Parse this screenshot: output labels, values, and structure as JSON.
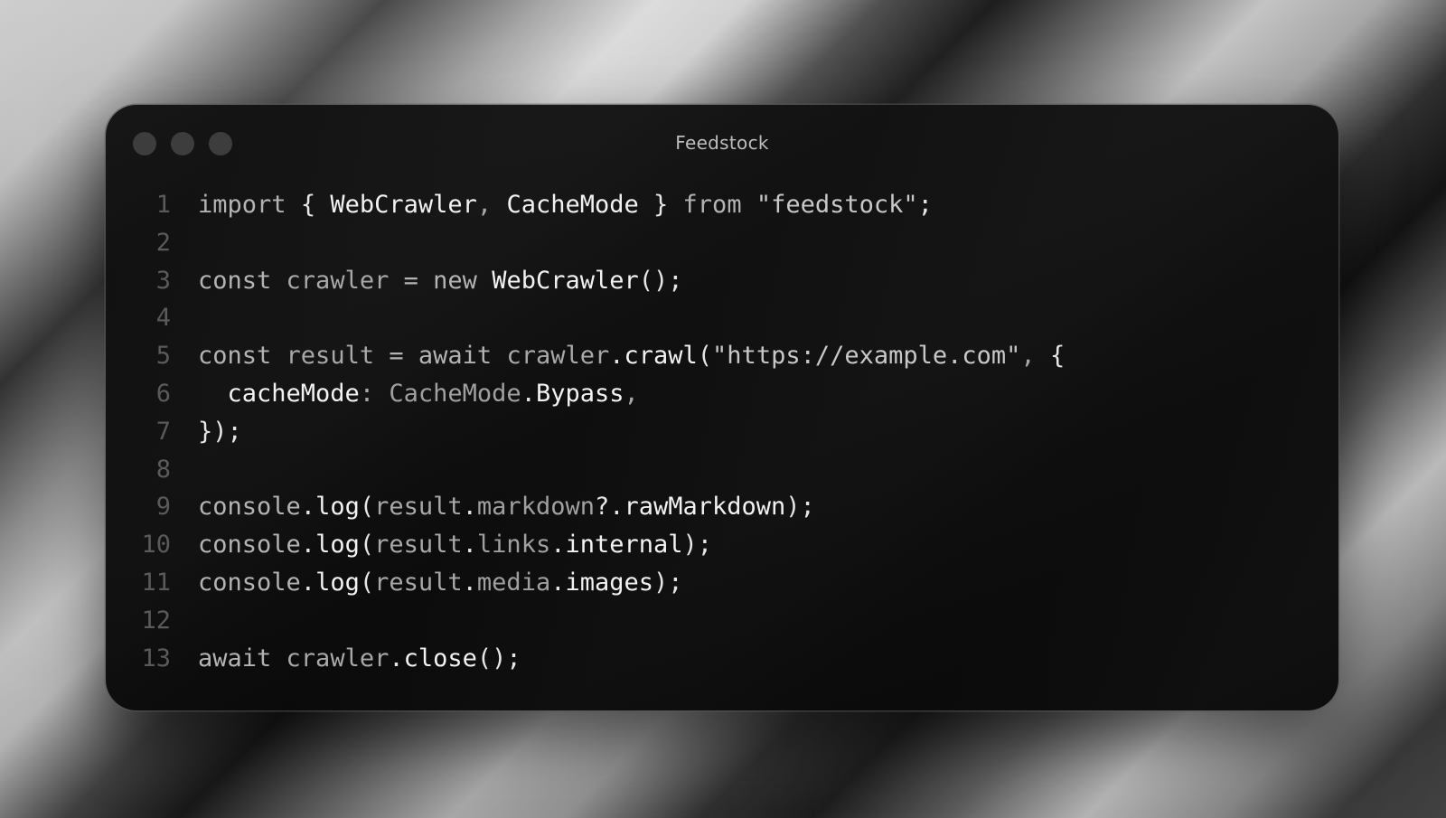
{
  "window": {
    "title": "Feedstock"
  },
  "code": {
    "lines": [
      {
        "number": "1",
        "tokens": [
          {
            "t": "import",
            "k": "kw"
          },
          {
            "t": " ",
            "k": "sp"
          },
          {
            "t": "{",
            "k": "pn"
          },
          {
            "t": " ",
            "k": "sp"
          },
          {
            "t": "WebCrawler",
            "k": "id"
          },
          {
            "t": ",",
            "k": "mut"
          },
          {
            "t": " ",
            "k": "sp"
          },
          {
            "t": "CacheMode",
            "k": "id"
          },
          {
            "t": " ",
            "k": "sp"
          },
          {
            "t": "}",
            "k": "pn"
          },
          {
            "t": " ",
            "k": "sp"
          },
          {
            "t": "from",
            "k": "kw"
          },
          {
            "t": " ",
            "k": "sp"
          },
          {
            "t": "\"feedstock\"",
            "k": "str"
          },
          {
            "t": ";",
            "k": "pn"
          }
        ]
      },
      {
        "number": "2",
        "tokens": []
      },
      {
        "number": "3",
        "tokens": [
          {
            "t": "const",
            "k": "kw"
          },
          {
            "t": " ",
            "k": "sp"
          },
          {
            "t": "crawler",
            "k": "mut"
          },
          {
            "t": " ",
            "k": "sp"
          },
          {
            "t": "=",
            "k": "kw"
          },
          {
            "t": " ",
            "k": "sp"
          },
          {
            "t": "new",
            "k": "kw"
          },
          {
            "t": " ",
            "k": "sp"
          },
          {
            "t": "WebCrawler",
            "k": "id"
          },
          {
            "t": "();",
            "k": "pn"
          }
        ]
      },
      {
        "number": "4",
        "tokens": []
      },
      {
        "number": "5",
        "tokens": [
          {
            "t": "const",
            "k": "kw"
          },
          {
            "t": " ",
            "k": "sp"
          },
          {
            "t": "result",
            "k": "mut"
          },
          {
            "t": " ",
            "k": "sp"
          },
          {
            "t": "=",
            "k": "kw"
          },
          {
            "t": " ",
            "k": "sp"
          },
          {
            "t": "await",
            "k": "kw"
          },
          {
            "t": " ",
            "k": "sp"
          },
          {
            "t": "crawler",
            "k": "mut"
          },
          {
            "t": ".",
            "k": "pn"
          },
          {
            "t": "crawl",
            "k": "id"
          },
          {
            "t": "(",
            "k": "pn"
          },
          {
            "t": "\"https://example.com\"",
            "k": "str"
          },
          {
            "t": ",",
            "k": "mut"
          },
          {
            "t": " ",
            "k": "sp"
          },
          {
            "t": "{",
            "k": "pn"
          }
        ]
      },
      {
        "number": "6",
        "tokens": [
          {
            "t": "  ",
            "k": "sp"
          },
          {
            "t": "cacheMode",
            "k": "id"
          },
          {
            "t": ":",
            "k": "mut"
          },
          {
            "t": " ",
            "k": "sp"
          },
          {
            "t": "CacheMode",
            "k": "pr"
          },
          {
            "t": ".",
            "k": "pn"
          },
          {
            "t": "Bypass",
            "k": "id"
          },
          {
            "t": ",",
            "k": "mut"
          }
        ]
      },
      {
        "number": "7",
        "tokens": [
          {
            "t": "});",
            "k": "pn"
          }
        ]
      },
      {
        "number": "8",
        "tokens": []
      },
      {
        "number": "9",
        "tokens": [
          {
            "t": "console",
            "k": "kw"
          },
          {
            "t": ".",
            "k": "pn"
          },
          {
            "t": "log",
            "k": "id"
          },
          {
            "t": "(",
            "k": "pn"
          },
          {
            "t": "result",
            "k": "mut"
          },
          {
            "t": ".",
            "k": "pn"
          },
          {
            "t": "markdown",
            "k": "pr"
          },
          {
            "t": "?.",
            "k": "pn"
          },
          {
            "t": "rawMarkdown",
            "k": "id"
          },
          {
            "t": ");",
            "k": "pn"
          }
        ]
      },
      {
        "number": "10",
        "tokens": [
          {
            "t": "console",
            "k": "kw"
          },
          {
            "t": ".",
            "k": "pn"
          },
          {
            "t": "log",
            "k": "id"
          },
          {
            "t": "(",
            "k": "pn"
          },
          {
            "t": "result",
            "k": "mut"
          },
          {
            "t": ".",
            "k": "pn"
          },
          {
            "t": "links",
            "k": "pr"
          },
          {
            "t": ".",
            "k": "pn"
          },
          {
            "t": "internal",
            "k": "id"
          },
          {
            "t": ");",
            "k": "pn"
          }
        ]
      },
      {
        "number": "11",
        "tokens": [
          {
            "t": "console",
            "k": "kw"
          },
          {
            "t": ".",
            "k": "pn"
          },
          {
            "t": "log",
            "k": "id"
          },
          {
            "t": "(",
            "k": "pn"
          },
          {
            "t": "result",
            "k": "mut"
          },
          {
            "t": ".",
            "k": "pn"
          },
          {
            "t": "media",
            "k": "pr"
          },
          {
            "t": ".",
            "k": "pn"
          },
          {
            "t": "images",
            "k": "id"
          },
          {
            "t": ");",
            "k": "pn"
          }
        ]
      },
      {
        "number": "12",
        "tokens": []
      },
      {
        "number": "13",
        "tokens": [
          {
            "t": "await",
            "k": "kw"
          },
          {
            "t": " ",
            "k": "sp"
          },
          {
            "t": "crawler",
            "k": "mut"
          },
          {
            "t": ".",
            "k": "pn"
          },
          {
            "t": "close",
            "k": "id"
          },
          {
            "t": "();",
            "k": "pn"
          }
        ]
      }
    ]
  }
}
